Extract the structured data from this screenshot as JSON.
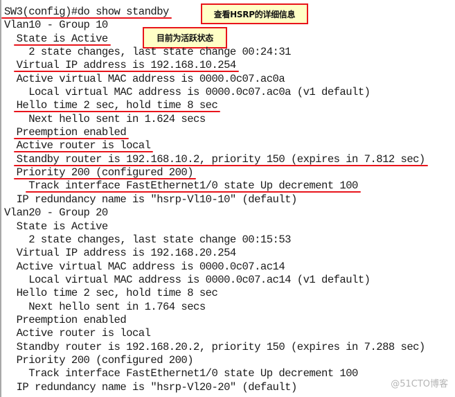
{
  "terminal": {
    "lines": [
      {
        "text": "SW3(config)#do show standby",
        "underlined": true
      },
      {
        "text": "Vlan10 - Group 10",
        "underlined": false
      },
      {
        "text": "  State is Active",
        "underlined": true
      },
      {
        "text": "    2 state changes, last state change 00:24:31",
        "underlined": false
      },
      {
        "text": "  Virtual IP address is 192.168.10.254",
        "underlined": true
      },
      {
        "text": "  Active virtual MAC address is 0000.0c07.ac0a",
        "underlined": false
      },
      {
        "text": "    Local virtual MAC address is 0000.0c07.ac0a (v1 default)",
        "underlined": false
      },
      {
        "text": "  Hello time 2 sec, hold time 8 sec",
        "underlined": true
      },
      {
        "text": "    Next hello sent in 1.624 secs",
        "underlined": false
      },
      {
        "text": "  Preemption enabled",
        "underlined": true
      },
      {
        "text": "  Active router is local",
        "underlined": true
      },
      {
        "text": "  Standby router is 192.168.10.2, priority 150 (expires in 7.812 sec)",
        "underlined": true
      },
      {
        "text": "  Priority 200 (configured 200)",
        "underlined": true
      },
      {
        "text": "    Track interface FastEthernet1/0 state Up decrement 100",
        "underlined": true
      },
      {
        "text": "  IP redundancy name is \"hsrp-Vl10-10\" (default)",
        "underlined": false
      },
      {
        "text": "Vlan20 - Group 20",
        "underlined": false
      },
      {
        "text": "  State is Active",
        "underlined": false
      },
      {
        "text": "    2 state changes, last state change 00:15:53",
        "underlined": false
      },
      {
        "text": "  Virtual IP address is 192.168.20.254",
        "underlined": false
      },
      {
        "text": "  Active virtual MAC address is 0000.0c07.ac14",
        "underlined": false
      },
      {
        "text": "    Local virtual MAC address is 0000.0c07.ac14 (v1 default)",
        "underlined": false
      },
      {
        "text": "  Hello time 2 sec, hold time 8 sec",
        "underlined": false
      },
      {
        "text": "    Next hello sent in 1.764 secs",
        "underlined": false
      },
      {
        "text": "  Preemption enabled",
        "underlined": false
      },
      {
        "text": "  Active router is local",
        "underlined": false
      },
      {
        "text": "  Standby router is 192.168.20.2, priority 150 (expires in 7.288 sec)",
        "underlined": false
      },
      {
        "text": "  Priority 200 (configured 200)",
        "underlined": false
      },
      {
        "text": "    Track interface FastEthernet1/0 state Up decrement 100",
        "underlined": false
      },
      {
        "text": "  IP redundancy name is \"hsrp-Vl20-20\" (default)",
        "underlined": false
      }
    ]
  },
  "callouts": {
    "view_hsrp_details": "查看HSRP的详细信息",
    "currently_active": "目前为活跃状态"
  },
  "watermark": "@51CTO博客",
  "colors": {
    "annotation_red": "#e8141b",
    "callout_fill": "#ffffc6",
    "text": "#1a1a1a",
    "watermark": "#b4b4b4"
  }
}
